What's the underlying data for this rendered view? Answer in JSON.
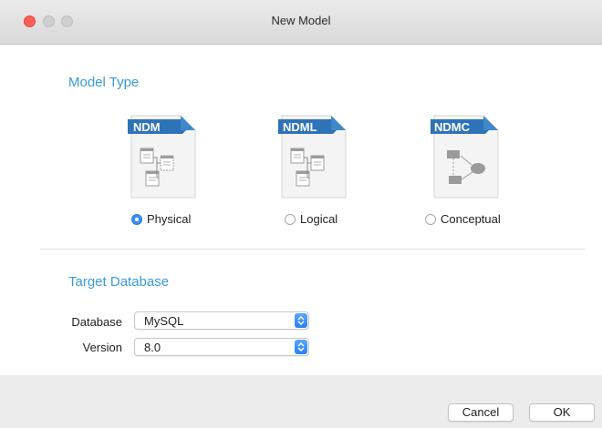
{
  "window": {
    "title": "New Model"
  },
  "model_type": {
    "heading": "Model Type",
    "options": [
      {
        "badge": "NDM",
        "label": "Physical",
        "selected": true,
        "icon": "physical-model-document-icon"
      },
      {
        "badge": "NDML",
        "label": "Logical",
        "selected": false,
        "icon": "logical-model-document-icon"
      },
      {
        "badge": "NDMC",
        "label": "Conceptual",
        "selected": false,
        "icon": "conceptual-model-document-icon"
      }
    ]
  },
  "target_database": {
    "heading": "Target Database",
    "database_label": "Database",
    "database_value": "MySQL",
    "version_label": "Version",
    "version_value": "8.0"
  },
  "buttons": {
    "cancel": "Cancel",
    "ok": "OK"
  },
  "colors": {
    "accent": "#3a9ad9",
    "badge": "#2e73b8",
    "radio_selected": "#3a8ef6"
  }
}
